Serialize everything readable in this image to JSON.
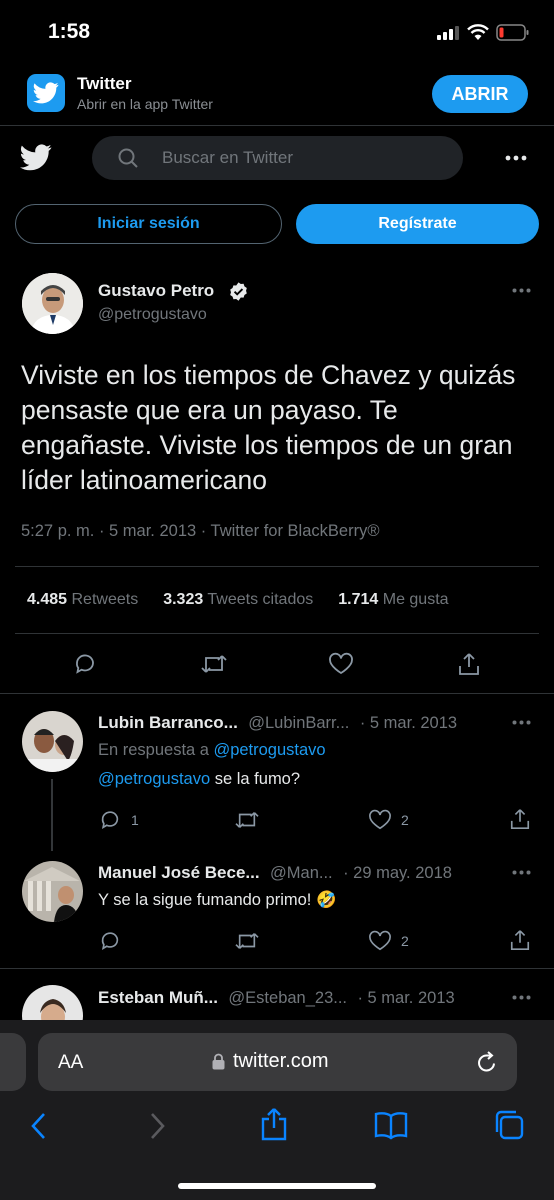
{
  "status_bar": {
    "time": "1:58"
  },
  "app_banner": {
    "title": "Twitter",
    "subtitle": "Abrir en la app Twitter",
    "open_label": "ABRIR"
  },
  "header": {
    "search_placeholder": "Buscar en Twitter"
  },
  "auth": {
    "login_label": "Iniciar sesión",
    "signup_label": "Regístrate"
  },
  "tweet": {
    "author_name": "Gustavo Petro",
    "author_handle": "@petrogustavo",
    "text": "Viviste en los tiempos de Chavez y quizás pensaste que era un payaso. Te engañaste. Viviste los tiempos de un gran líder latinoamericano",
    "meta": "5:27 p. m. · 5 mar. 2013 · Twitter for BlackBerry®",
    "stats": [
      {
        "value": "4.485",
        "label": "Retweets"
      },
      {
        "value": "3.323",
        "label": "Tweets citados"
      },
      {
        "value": "1.714",
        "label": "Me gusta"
      }
    ]
  },
  "replies": [
    {
      "name": "Lubin Barranco...",
      "handle": "@LubinBarr...",
      "date": "· 5 mar. 2013",
      "reply_to_prefix": "En respuesta a",
      "reply_to_handle": "@petrogustavo",
      "mention": "@petrogustavo",
      "text": " se la fumo?",
      "reply_count": "1",
      "like_count": "2"
    },
    {
      "name": "Manuel José Bece...",
      "handle": "@Man...",
      "date": "· 29 may. 2018",
      "text": "Y se la sigue fumando primo! 🤣",
      "like_count": "2"
    },
    {
      "name": "Esteban Muñ...",
      "handle": "@Esteban_23...",
      "date": "· 5 mar. 2013"
    }
  ],
  "safari": {
    "aa_label": "AA",
    "url": "twitter.com"
  },
  "colors": {
    "accent": "#1d9bf0",
    "background": "#000000",
    "muted": "#71767b"
  }
}
